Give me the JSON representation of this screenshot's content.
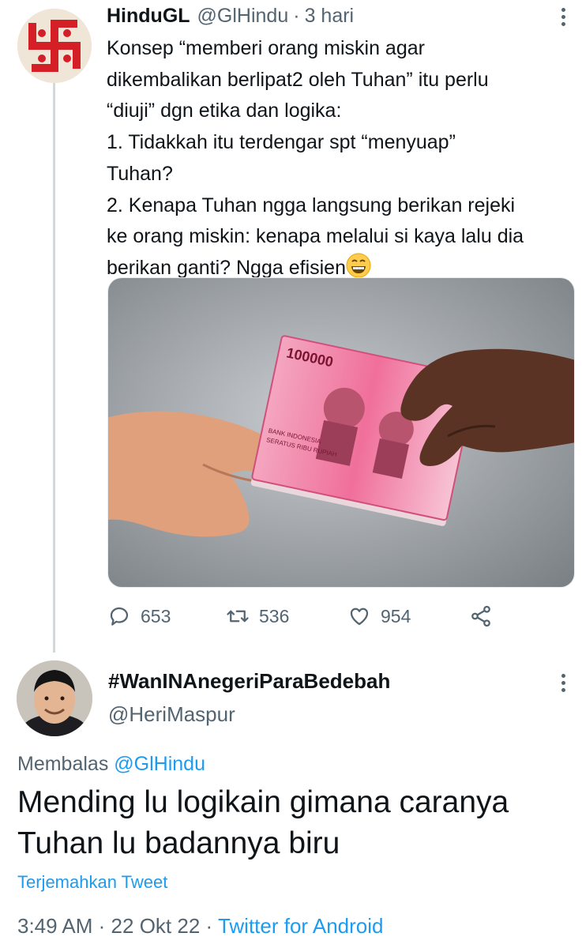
{
  "tweet": {
    "author_name": "HinduGL",
    "author_handle": "@GlHindu",
    "separator": "·",
    "time": "3 hari",
    "avatar_icon": "swastika-icon",
    "body_lines": [
      "Konsep “memberi orang miskin agar",
      "dikembalikan berlipat2 oleh Tuhan” itu perlu",
      "“diuji” dgn etika dan logika:",
      "1. Tidakkah itu terdengar spt “menyuap”",
      "Tuhan?",
      "2. Kenapa Tuhan ngga langsung berikan rejeki",
      "ke orang miskin: kenapa melalui si kaya lalu dia",
      "berikan ganti? Ngga efisien"
    ],
    "media": {
      "banknote_value": "100000",
      "banknote_text": "SERATUS RIBU RUPIAH",
      "bank_text": "BANK INDONESIA"
    },
    "stats": {
      "replies": "653",
      "retweets": "536",
      "likes": "954"
    }
  },
  "reply": {
    "author_name": "#WanINAnegeriParaBedebah",
    "author_handle": "@HeriMaspur",
    "replying_label": "Membalas",
    "replying_to": "@GlHindu",
    "body_lines": [
      "Mending lu logikain gimana caranya",
      "Tuhan lu badannya biru"
    ],
    "translate_label": "Terjemahkan Tweet",
    "time": "3:49 AM",
    "sep1": "·",
    "date": "22 Okt 22",
    "sep2": "·",
    "source": "Twitter for Android"
  },
  "colors": {
    "link": "#1d9bf0",
    "secondary_text": "#536471",
    "primary_text": "#0f1419",
    "thread_line": "#cfd9de"
  }
}
